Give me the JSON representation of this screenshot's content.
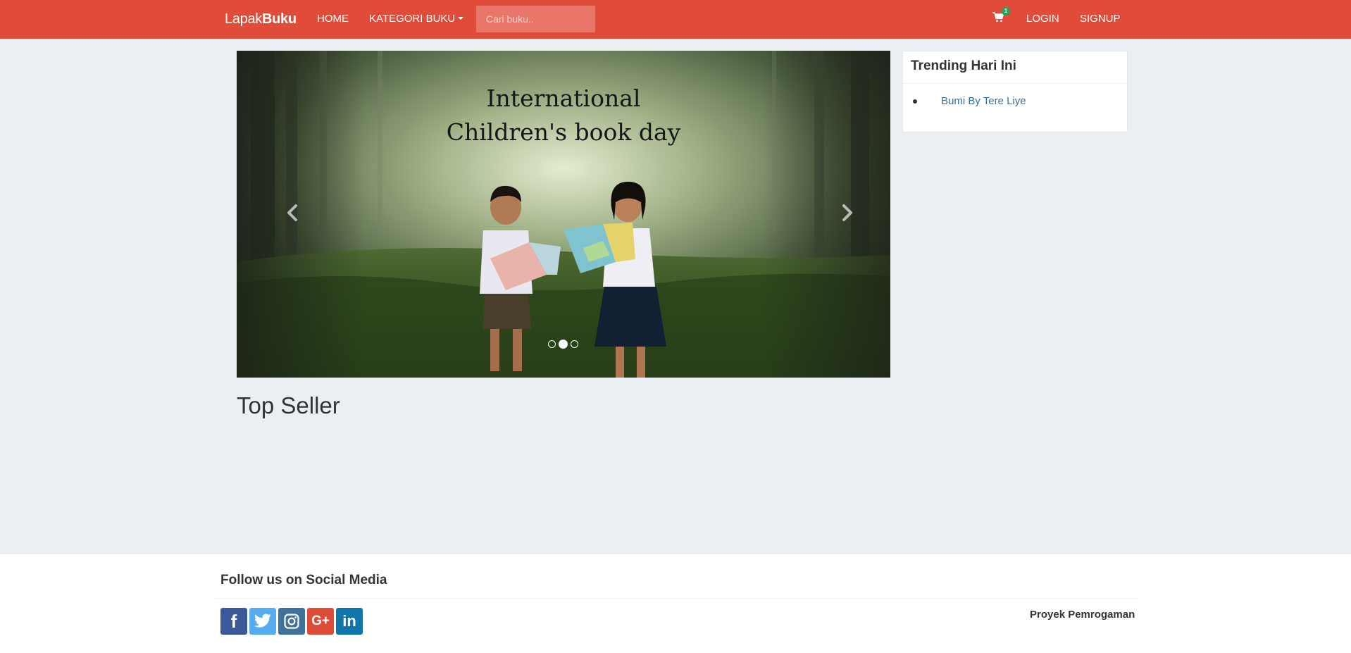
{
  "navbar": {
    "brand_light": "Lapak",
    "brand_bold": "Buku",
    "home": "HOME",
    "kategori": "KATEGORI BUKU",
    "search_placeholder": "Cari buku..",
    "cart_count": "1",
    "login": "LOGIN",
    "signup": "SIGNUP",
    "bg_color": "#e14c3a"
  },
  "carousel": {
    "caption_line1": "International",
    "caption_line2": "Children's book day",
    "slide_count": 3,
    "active_index": 1
  },
  "trending": {
    "title": "Trending Hari Ini",
    "items": [
      {
        "label": "Bumi By Tere Liye"
      }
    ]
  },
  "top_seller": {
    "title": "Top Seller"
  },
  "footer": {
    "social_title": "Follow us on Social Media",
    "socials": [
      {
        "name": "facebook-icon",
        "glyph": "f"
      },
      {
        "name": "twitter-icon",
        "glyph": ""
      },
      {
        "name": "instagram-icon",
        "glyph": ""
      },
      {
        "name": "google-plus-icon",
        "glyph": "G+"
      },
      {
        "name": "linkedin-icon",
        "glyph": "in"
      }
    ],
    "credit": "Proyek Pemrogaman"
  }
}
